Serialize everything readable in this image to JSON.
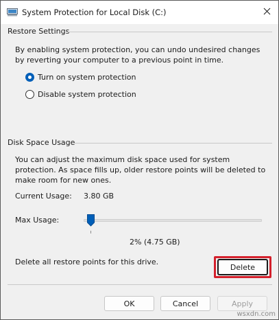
{
  "window": {
    "title": "System Protection for Local Disk (C:)",
    "icon": "system-properties-icon",
    "close_icon": "close-icon"
  },
  "restore_settings": {
    "label": "Restore Settings",
    "description": "By enabling system protection, you can undo undesired changes by reverting your computer to a previous point in time.",
    "options": [
      {
        "label": "Turn on system protection",
        "checked": true
      },
      {
        "label": "Disable system protection",
        "checked": false
      }
    ]
  },
  "disk_space": {
    "label": "Disk Space Usage",
    "description": "You can adjust the maximum disk space used for system protection. As space fills up, older restore points will be deleted to make room for new ones.",
    "current_usage_label": "Current Usage:",
    "current_usage_value": "3.80 GB",
    "max_usage_label": "Max Usage:",
    "max_usage_percent": 2,
    "max_usage_value": "2% (4.75 GB)",
    "delete_text": "Delete all restore points for this drive.",
    "delete_label": "Delete"
  },
  "footer": {
    "ok_label": "OK",
    "cancel_label": "Cancel",
    "apply_label": "Apply"
  },
  "watermark": "wsxdn.com",
  "colors": {
    "accent": "#005fb8",
    "highlight": "#d4202c"
  }
}
